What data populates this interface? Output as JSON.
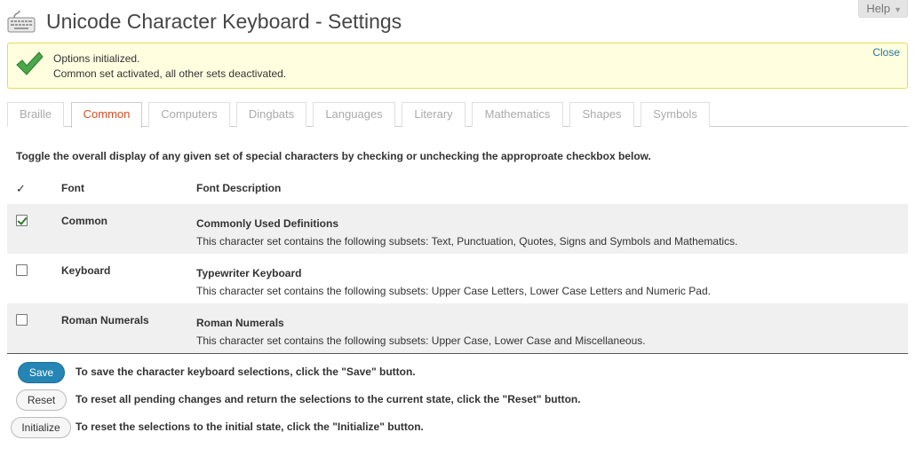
{
  "header": {
    "title": "Unicode Character Keyboard - Settings",
    "help_label": "Help",
    "icon": "keyboard-icon"
  },
  "notice": {
    "line1": "Options initialized.",
    "line2": "Common set activated, all other sets deactivated.",
    "close_label": "Close",
    "icon": "checkmark-icon"
  },
  "tabs": [
    {
      "label": "Braille"
    },
    {
      "label": "Common",
      "active": true
    },
    {
      "label": "Computers"
    },
    {
      "label": "Dingbats"
    },
    {
      "label": "Languages"
    },
    {
      "label": "Literary"
    },
    {
      "label": "Mathematics"
    },
    {
      "label": "Shapes"
    },
    {
      "label": "Symbols"
    }
  ],
  "intro": "Toggle the overall display of any given set of special characters by checking or unchecking the approproate checkbox below.",
  "table": {
    "headers": {
      "check": "✓",
      "font": "Font",
      "description": "Font Description"
    },
    "rows": [
      {
        "checked": true,
        "font": "Common",
        "title": "Commonly Used Definitions",
        "subtitle": "This character set contains the following subsets: Text, Punctuation, Quotes, Signs and Symbols and Mathematics."
      },
      {
        "checked": false,
        "font": "Keyboard",
        "title": "Typewriter Keyboard",
        "subtitle": "This character set contains the following subsets: Upper Case Letters, Lower Case Letters and Numeric Pad."
      },
      {
        "checked": false,
        "font": "Roman Numerals",
        "title": "Roman Numerals",
        "subtitle": "This character set contains the following subsets: Upper Case, Lower Case and Miscellaneous."
      }
    ]
  },
  "actions": {
    "save": {
      "label": "Save",
      "description": "To save the character keyboard selections, click the \"Save\" button."
    },
    "reset": {
      "label": "Reset",
      "description": "To reset all pending changes and return the selections to the current state, click the \"Reset\" button."
    },
    "initialize": {
      "label": "Initialize",
      "description": "To reset the selections to the initial state, click the \"Initialize\" button."
    }
  },
  "colors": {
    "accent": "#d54e21",
    "primary_button": "#2585b5",
    "notice_bg": "#ffffe0",
    "notice_border": "#e6db55",
    "link": "#21759b",
    "check": "#3c9a3c"
  }
}
